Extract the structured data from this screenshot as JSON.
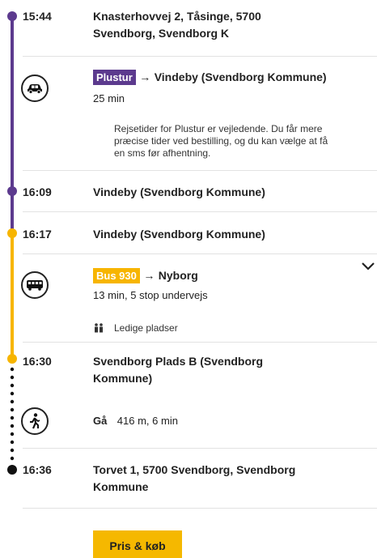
{
  "colors": {
    "plustur": "#5c3a8e",
    "bus": "#f7b500",
    "text": "#222222"
  },
  "stops": [
    {
      "time": "15:44",
      "place_line1": "Knasterhovvej 2, Tåsinge, 5700",
      "place_line2": "Svendborg, Svendborg K"
    },
    {
      "time": "16:09",
      "place_line1": "Vindeby (Svendborg Kommune)"
    },
    {
      "time": "16:17",
      "place_line1": "Vindeby (Svendborg Kommune)"
    },
    {
      "time": "16:30",
      "place_line1": "Svendborg Plads B (Svendborg",
      "place_line2": "Kommune)"
    },
    {
      "time": "16:36",
      "place_line1": "Torvet 1, 5700 Svendborg, Svendborg",
      "place_line2": "Kommune"
    }
  ],
  "legs": {
    "plustur": {
      "badge": "Plustur",
      "arrow": "→",
      "destination": "Vindeby (Svendborg Kommune)",
      "duration": "25 min",
      "note_line1": "Rejsetider for Plustur er vejledende. Du får mere",
      "note_line2": "præcise tider ved bestilling, og du kan vælge at få",
      "note_line3": "en sms før afhentning.",
      "icon": "taxi-icon"
    },
    "bus": {
      "badge": "Bus 930",
      "arrow": "→",
      "destination": "Nyborg",
      "details": "13 min, 5 stop undervejs",
      "seats": "Ledige pladser",
      "icon": "bus-icon",
      "seats_icon": "people-icon",
      "expand_icon": "chevron-down-icon"
    },
    "walk": {
      "label": "Gå",
      "details": "416 m, 6 min",
      "icon": "walking-icon"
    }
  },
  "actions": {
    "buy_label": "Pris & køb"
  }
}
